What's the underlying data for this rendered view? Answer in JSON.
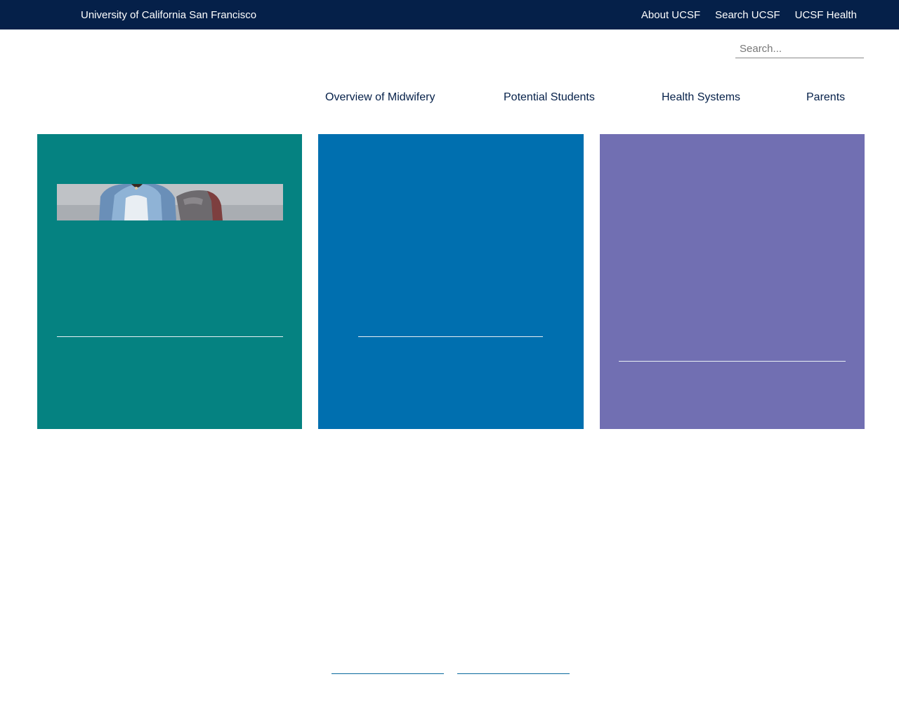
{
  "topbar": {
    "brand": "University of California San Francisco",
    "links": [
      "About UCSF",
      "Search UCSF",
      "UCSF Health"
    ]
  },
  "search": {
    "placeholder": "Search..."
  },
  "nav": {
    "items": [
      "Overview of Midwifery",
      "Potential Students",
      "Health Systems",
      "Parents"
    ]
  },
  "colors": {
    "topbar": "#052049",
    "card_teal": "#058281",
    "card_blue": "#006FAF",
    "card_purple": "#716FB2",
    "nav_text": "#052049"
  },
  "icons": {
    "card_image": "student-photo"
  }
}
